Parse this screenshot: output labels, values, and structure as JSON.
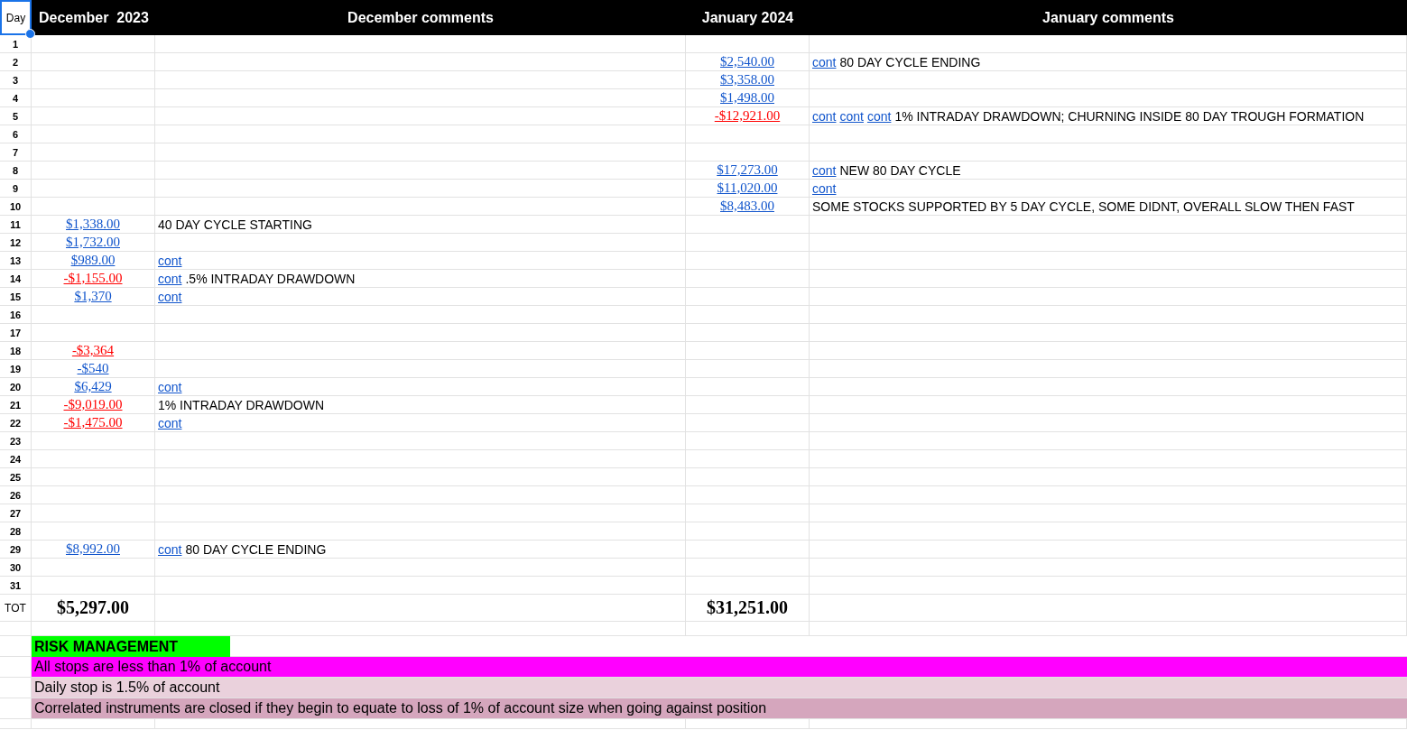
{
  "header": {
    "day": {
      "text": "Day",
      "selected": true
    },
    "dec_amount": "December  2023",
    "dec_comments": "December comments",
    "jan_amount": "January 2024",
    "jan_comments": "January comments"
  },
  "rows": [
    {
      "day": "1"
    },
    {
      "day": "2",
      "jan_amount": {
        "text": "$2,540.00",
        "color": "#1155cc"
      },
      "jan_comment": [
        {
          "kind": "link",
          "text": "cont"
        },
        {
          "kind": "text",
          "text": "80 DAY CYCLE ENDING"
        }
      ]
    },
    {
      "day": "3",
      "jan_amount": {
        "text": "$3,358.00",
        "color": "#1155cc"
      }
    },
    {
      "day": "4",
      "jan_amount": {
        "text": "$1,498.00",
        "color": "#1155cc"
      }
    },
    {
      "day": "5",
      "jan_amount": {
        "text": "-$12,921.00",
        "color": "#ff0000"
      },
      "jan_comment": [
        {
          "kind": "link",
          "text": "cont"
        },
        {
          "kind": "link",
          "text": "cont"
        },
        {
          "kind": "link",
          "text": "cont"
        },
        {
          "kind": "text",
          "text": "1% INTRADAY DRAWDOWN; CHURNING INSIDE 80 DAY TROUGH FORMATION"
        }
      ]
    },
    {
      "day": "6"
    },
    {
      "day": "7"
    },
    {
      "day": "8",
      "jan_amount": {
        "text": "$17,273.00",
        "color": "#1155cc"
      },
      "jan_comment": [
        {
          "kind": "link",
          "text": "cont"
        },
        {
          "kind": "text",
          "text": "NEW 80 DAY CYCLE"
        }
      ]
    },
    {
      "day": "9",
      "jan_amount": {
        "text": "$11,020.00",
        "color": "#1155cc"
      },
      "jan_comment": [
        {
          "kind": "link",
          "text": "cont"
        }
      ]
    },
    {
      "day": "10",
      "jan_amount": {
        "text": "$8,483.00",
        "color": "#1155cc"
      },
      "jan_comment": [
        {
          "kind": "text",
          "text": "SOME STOCKS SUPPORTED BY 5 DAY CYCLE, SOME DIDNT, OVERALL SLOW THEN FAST"
        }
      ]
    },
    {
      "day": "11",
      "dec_amount": {
        "text": "$1,338.00",
        "color": "#1155cc"
      },
      "dec_comment": [
        {
          "kind": "text",
          "text": "40 DAY CYCLE STARTING"
        }
      ]
    },
    {
      "day": "12",
      "dec_amount": {
        "text": "$1,732.00",
        "color": "#1155cc"
      }
    },
    {
      "day": "13",
      "dec_amount": {
        "text": "$989.00",
        "color": "#1155cc"
      },
      "dec_comment": [
        {
          "kind": "link",
          "text": "cont"
        }
      ]
    },
    {
      "day": "14",
      "dec_amount": {
        "text": "-$1,155.00",
        "color": "#ff0000"
      },
      "dec_comment": [
        {
          "kind": "link",
          "text": "cont"
        },
        {
          "kind": "text",
          "text": ".5% INTRADAY DRAWDOWN"
        }
      ]
    },
    {
      "day": "15",
      "dec_amount": {
        "text": "$1,370",
        "color": "#1155cc"
      },
      "dec_comment": [
        {
          "kind": "link",
          "text": "cont"
        }
      ]
    },
    {
      "day": "16"
    },
    {
      "day": "17"
    },
    {
      "day": "18",
      "dec_amount": {
        "text": "-$3,364",
        "color": "#ff0000"
      }
    },
    {
      "day": "19",
      "dec_amount": {
        "text": "-$540",
        "color": "#1155cc"
      }
    },
    {
      "day": "20",
      "dec_amount": {
        "text": "$6,429",
        "color": "#1155cc"
      },
      "dec_comment": [
        {
          "kind": "link",
          "text": "cont"
        }
      ]
    },
    {
      "day": "21",
      "dec_amount": {
        "text": "-$9,019.00",
        "color": "#ff0000"
      },
      "dec_comment": [
        {
          "kind": "text",
          "text": "1% INTRADAY DRAWDOWN"
        }
      ]
    },
    {
      "day": "22",
      "dec_amount": {
        "text": "-$1,475.00",
        "color": "#ff0000"
      },
      "dec_comment": [
        {
          "kind": "link",
          "text": "cont"
        }
      ]
    },
    {
      "day": "23"
    },
    {
      "day": "24"
    },
    {
      "day": "25"
    },
    {
      "day": "26"
    },
    {
      "day": "27"
    },
    {
      "day": "28"
    },
    {
      "day": "29",
      "dec_amount": {
        "text": "$8,992.00",
        "color": "#1155cc"
      },
      "dec_comment": [
        {
          "kind": "link",
          "text": "cont"
        },
        {
          "kind": "text",
          "text": "80 DAY CYCLE ENDING"
        }
      ]
    },
    {
      "day": "30"
    },
    {
      "day": "31"
    }
  ],
  "totals": {
    "label": "TOT",
    "dec": "$5,297.00",
    "jan": "$31,251.00"
  },
  "risk": {
    "title": "RISK MANAGEMENT",
    "lines": [
      {
        "text": "All stops are less than 1% of account",
        "color": "#ff00ff"
      },
      {
        "text": "Daily stop is 1.5% of account",
        "color": "#ead1dc"
      },
      {
        "text": "Correlated instruments are closed if they begin to equate to loss of 1% of account size when going against position",
        "color": "#d5a6bd"
      }
    ]
  }
}
